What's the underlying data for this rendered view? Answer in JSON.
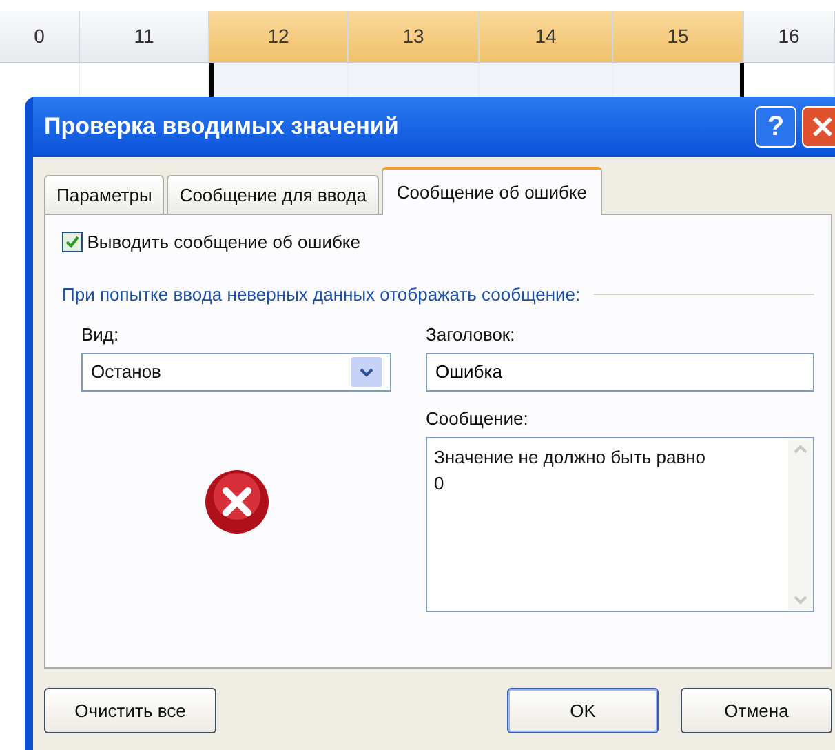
{
  "sheet": {
    "columns": [
      {
        "label": "0",
        "selected": false
      },
      {
        "label": "11",
        "selected": false
      },
      {
        "label": "12",
        "selected": true
      },
      {
        "label": "13",
        "selected": true
      },
      {
        "label": "14",
        "selected": true
      },
      {
        "label": "15",
        "selected": true
      },
      {
        "label": "16",
        "selected": false
      }
    ]
  },
  "dialog": {
    "title": "Проверка вводимых значений",
    "help_button": "?",
    "tabs": [
      {
        "label": "Параметры",
        "selected": false
      },
      {
        "label": "Сообщение для ввода",
        "selected": false
      },
      {
        "label": "Сообщение об ошибке",
        "selected": true
      }
    ],
    "show_error": {
      "label": "Выводить сообщение об ошибке",
      "checked": true
    },
    "group_label": "При попытке ввода неверных данных отображать сообщение:",
    "style": {
      "label": "Вид:",
      "value": "Останов"
    },
    "title_field": {
      "label": "Заголовок:",
      "value": "Ошибка"
    },
    "message_field": {
      "label": "Сообщение:",
      "value": "Значение не должно быть равно\n0"
    },
    "buttons": [
      {
        "label": "Очистить все",
        "default": false
      },
      {
        "label": "OK",
        "default": true
      },
      {
        "label": "Отмена",
        "default": false
      }
    ]
  }
}
